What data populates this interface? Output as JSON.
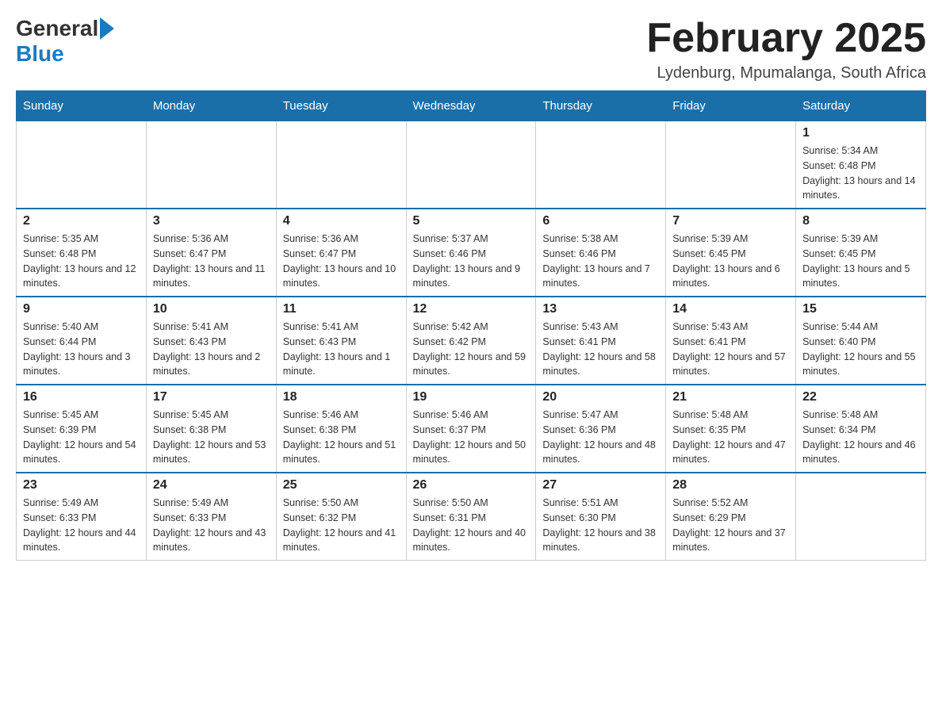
{
  "header": {
    "logo_general": "General",
    "logo_blue": "Blue",
    "month_title": "February 2025",
    "location": "Lydenburg, Mpumalanga, South Africa"
  },
  "days_of_week": [
    "Sunday",
    "Monday",
    "Tuesday",
    "Wednesday",
    "Thursday",
    "Friday",
    "Saturday"
  ],
  "weeks": [
    [
      {
        "day": "",
        "info": ""
      },
      {
        "day": "",
        "info": ""
      },
      {
        "day": "",
        "info": ""
      },
      {
        "day": "",
        "info": ""
      },
      {
        "day": "",
        "info": ""
      },
      {
        "day": "",
        "info": ""
      },
      {
        "day": "1",
        "info": "Sunrise: 5:34 AM\nSunset: 6:48 PM\nDaylight: 13 hours and 14 minutes."
      }
    ],
    [
      {
        "day": "2",
        "info": "Sunrise: 5:35 AM\nSunset: 6:48 PM\nDaylight: 13 hours and 12 minutes."
      },
      {
        "day": "3",
        "info": "Sunrise: 5:36 AM\nSunset: 6:47 PM\nDaylight: 13 hours and 11 minutes."
      },
      {
        "day": "4",
        "info": "Sunrise: 5:36 AM\nSunset: 6:47 PM\nDaylight: 13 hours and 10 minutes."
      },
      {
        "day": "5",
        "info": "Sunrise: 5:37 AM\nSunset: 6:46 PM\nDaylight: 13 hours and 9 minutes."
      },
      {
        "day": "6",
        "info": "Sunrise: 5:38 AM\nSunset: 6:46 PM\nDaylight: 13 hours and 7 minutes."
      },
      {
        "day": "7",
        "info": "Sunrise: 5:39 AM\nSunset: 6:45 PM\nDaylight: 13 hours and 6 minutes."
      },
      {
        "day": "8",
        "info": "Sunrise: 5:39 AM\nSunset: 6:45 PM\nDaylight: 13 hours and 5 minutes."
      }
    ],
    [
      {
        "day": "9",
        "info": "Sunrise: 5:40 AM\nSunset: 6:44 PM\nDaylight: 13 hours and 3 minutes."
      },
      {
        "day": "10",
        "info": "Sunrise: 5:41 AM\nSunset: 6:43 PM\nDaylight: 13 hours and 2 minutes."
      },
      {
        "day": "11",
        "info": "Sunrise: 5:41 AM\nSunset: 6:43 PM\nDaylight: 13 hours and 1 minute."
      },
      {
        "day": "12",
        "info": "Sunrise: 5:42 AM\nSunset: 6:42 PM\nDaylight: 12 hours and 59 minutes."
      },
      {
        "day": "13",
        "info": "Sunrise: 5:43 AM\nSunset: 6:41 PM\nDaylight: 12 hours and 58 minutes."
      },
      {
        "day": "14",
        "info": "Sunrise: 5:43 AM\nSunset: 6:41 PM\nDaylight: 12 hours and 57 minutes."
      },
      {
        "day": "15",
        "info": "Sunrise: 5:44 AM\nSunset: 6:40 PM\nDaylight: 12 hours and 55 minutes."
      }
    ],
    [
      {
        "day": "16",
        "info": "Sunrise: 5:45 AM\nSunset: 6:39 PM\nDaylight: 12 hours and 54 minutes."
      },
      {
        "day": "17",
        "info": "Sunrise: 5:45 AM\nSunset: 6:38 PM\nDaylight: 12 hours and 53 minutes."
      },
      {
        "day": "18",
        "info": "Sunrise: 5:46 AM\nSunset: 6:38 PM\nDaylight: 12 hours and 51 minutes."
      },
      {
        "day": "19",
        "info": "Sunrise: 5:46 AM\nSunset: 6:37 PM\nDaylight: 12 hours and 50 minutes."
      },
      {
        "day": "20",
        "info": "Sunrise: 5:47 AM\nSunset: 6:36 PM\nDaylight: 12 hours and 48 minutes."
      },
      {
        "day": "21",
        "info": "Sunrise: 5:48 AM\nSunset: 6:35 PM\nDaylight: 12 hours and 47 minutes."
      },
      {
        "day": "22",
        "info": "Sunrise: 5:48 AM\nSunset: 6:34 PM\nDaylight: 12 hours and 46 minutes."
      }
    ],
    [
      {
        "day": "23",
        "info": "Sunrise: 5:49 AM\nSunset: 6:33 PM\nDaylight: 12 hours and 44 minutes."
      },
      {
        "day": "24",
        "info": "Sunrise: 5:49 AM\nSunset: 6:33 PM\nDaylight: 12 hours and 43 minutes."
      },
      {
        "day": "25",
        "info": "Sunrise: 5:50 AM\nSunset: 6:32 PM\nDaylight: 12 hours and 41 minutes."
      },
      {
        "day": "26",
        "info": "Sunrise: 5:50 AM\nSunset: 6:31 PM\nDaylight: 12 hours and 40 minutes."
      },
      {
        "day": "27",
        "info": "Sunrise: 5:51 AM\nSunset: 6:30 PM\nDaylight: 12 hours and 38 minutes."
      },
      {
        "day": "28",
        "info": "Sunrise: 5:52 AM\nSunset: 6:29 PM\nDaylight: 12 hours and 37 minutes."
      },
      {
        "day": "",
        "info": ""
      }
    ]
  ]
}
